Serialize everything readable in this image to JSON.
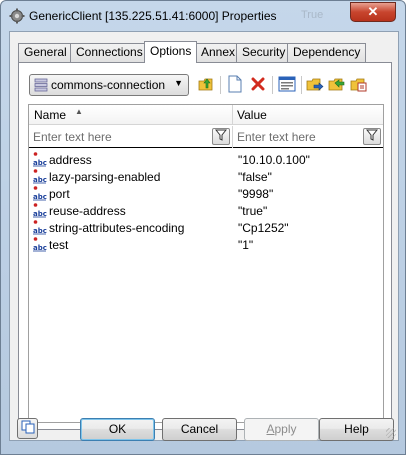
{
  "window": {
    "title": "GenericClient [135.225.51.41:6000] Properties",
    "background_title_fragment": "True",
    "close_glyph": "✕"
  },
  "tabs": [
    {
      "label": "General",
      "active": false
    },
    {
      "label": "Connections",
      "active": false
    },
    {
      "label": "Options",
      "active": true
    },
    {
      "label": "Annex",
      "active": false
    },
    {
      "label": "Security",
      "active": false
    },
    {
      "label": "Dependency",
      "active": false
    }
  ],
  "toolbar": {
    "combo_value": "commons-connection",
    "combo_arrow": "▼",
    "buttons": [
      "up-folder-icon",
      "new-document-icon",
      "delete-icon",
      "properties-icon",
      "export-icon",
      "import-icon",
      "copy-icon"
    ]
  },
  "grid": {
    "columns": {
      "name": "Name",
      "value": "Value"
    },
    "sort_indicator": "▲",
    "filter_placeholder_name": "Enter text here",
    "filter_placeholder_value": "Enter text here",
    "rows": [
      {
        "name": "address",
        "value": "\"10.10.0.100\""
      },
      {
        "name": "lazy-parsing-enabled",
        "value": "\"false\""
      },
      {
        "name": "port",
        "value": "\"9998\""
      },
      {
        "name": "reuse-address",
        "value": "\"true\""
      },
      {
        "name": "string-attributes-encoding",
        "value": "\"Cp1252\""
      },
      {
        "name": "test",
        "value": "\"1\""
      }
    ]
  },
  "buttons": {
    "ok": "OK",
    "cancel": "Cancel",
    "apply_mnemonic": "A",
    "apply_rest": "pply",
    "help": "Help"
  },
  "colors": {
    "accent_border": "#3c7fb1",
    "delete_red": "#d22b1e",
    "icon_gold": "#e8b020",
    "icon_green": "#3aa535",
    "icon_blue": "#2a62b8"
  }
}
